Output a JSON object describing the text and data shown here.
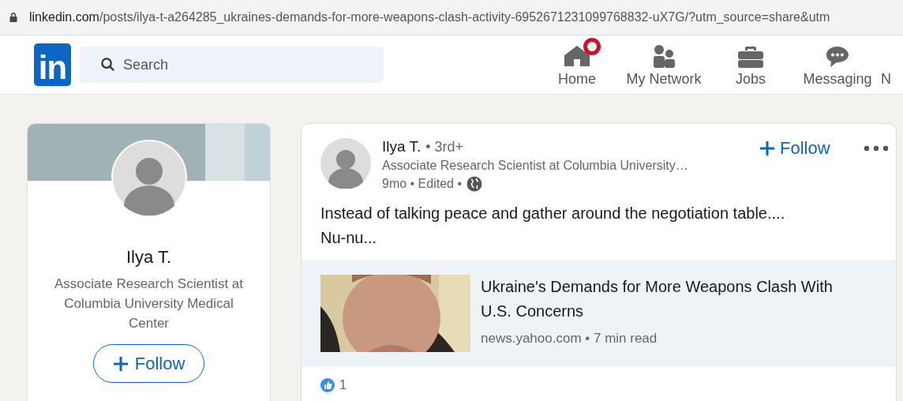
{
  "address_bar": {
    "url": "linkedin.com",
    "path": "/posts/ilya-t-a264285_ukraines-demands-for-more-weapons-clash-activity-6952671231099768832-uX7G/?utm_source=share&utm"
  },
  "header": {
    "logo": "in",
    "search": {
      "placeholder": "Search"
    },
    "nav": [
      {
        "kind": "home",
        "label": "Home",
        "notification": true
      },
      {
        "kind": "network",
        "label": "My Network",
        "notification": false
      },
      {
        "kind": "jobs",
        "label": "Jobs",
        "notification": false
      },
      {
        "kind": "messaging",
        "label": "Messaging",
        "notification": false
      },
      {
        "kind": "cut",
        "label": "N",
        "notification": false
      }
    ]
  },
  "profile_card": {
    "name": "Ilya T.",
    "headline": "Associate Research Scientist at Columbia University Medical Center",
    "follow": "Follow"
  },
  "post": {
    "author": "Ilya T.",
    "degree": "• 3rd+",
    "headline": "Associate Research Scientist at Columbia University…",
    "meta": "9mo • Edited •",
    "follow": "Follow",
    "text": [
      "Instead of talking peace and gather around the negotiation table....",
      "Nu-nu..."
    ],
    "article": {
      "title": "Ukraine's Demands for More Weapons Clash With U.S. Concerns",
      "source": "news.yahoo.com • 7 min read"
    },
    "reactions": {
      "count": "1"
    }
  }
}
